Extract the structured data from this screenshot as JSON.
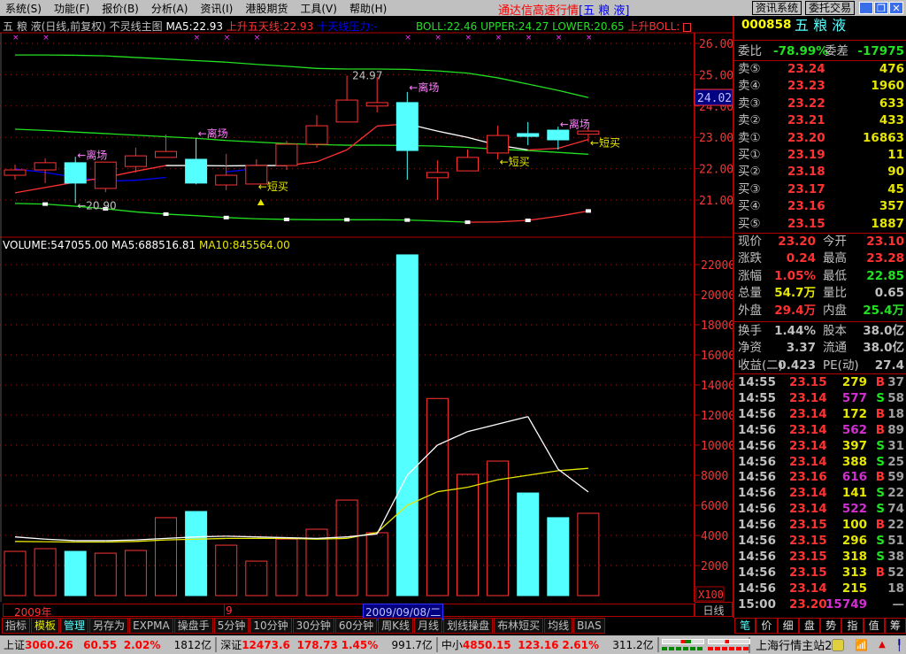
{
  "menu": [
    "系统(S)",
    "功能(F)",
    "报价(B)",
    "分析(A)",
    "资讯(I)",
    "港股期货",
    "工具(V)",
    "帮助(H)"
  ],
  "app_title": "通达信高速行情",
  "app_stock": "[五 粮 液]",
  "top_buttons": {
    "news": "资讯系统",
    "trade": "委托交易"
  },
  "window_controls": {
    "minimize": "_",
    "restore": "❐",
    "close": "✕"
  },
  "chart_header": {
    "name": "五 粮 液(日线,前复权) 不灵线主图",
    "ma5": "MA5:22.93",
    "up5": "上升五天线:22.93",
    "ten": "十天线压力:-",
    "boll": "BOLL:22.46",
    "upper": "UPPER:24.27",
    "lower": "LOWER:20.65",
    "upboll": "上升BOLL:"
  },
  "volume_header": {
    "vol": "VOLUME:547055.00",
    "ma5": "MA5:688516.81",
    "ma10": "MA10:845564.00"
  },
  "chart_data": [
    {
      "type": "candlestick",
      "title": "五粮液 日线",
      "price_ticks": [
        "26.00",
        "25.00",
        "24.00",
        "23.00",
        "22.00",
        "21.00"
      ],
      "price_range": [
        20.0,
        26.4
      ],
      "current_price_tag": "24.02",
      "candles": [
        {
          "o": 21.79,
          "h": 22.13,
          "l": 21.65,
          "c": 21.96
        },
        {
          "o": 21.96,
          "h": 22.33,
          "l": 21.54,
          "c": 22.19
        },
        {
          "o": 22.19,
          "h": 22.38,
          "l": 20.9,
          "c": 21.54
        },
        {
          "o": 21.37,
          "h": 22.21,
          "l": 21.25,
          "c": 22.21
        },
        {
          "o": 22.07,
          "h": 22.67,
          "l": 21.88,
          "c": 22.41
        },
        {
          "o": 22.36,
          "h": 23.09,
          "l": 22.36,
          "c": 22.55
        },
        {
          "o": 22.3,
          "h": 22.98,
          "l": 21.5,
          "c": 21.54
        },
        {
          "o": 21.48,
          "h": 22.47,
          "l": 21.31,
          "c": 21.79
        },
        {
          "o": 21.51,
          "h": 22.3,
          "l": 21.51,
          "c": 22.1
        },
        {
          "o": 22.1,
          "h": 22.89,
          "l": 21.96,
          "c": 22.78
        },
        {
          "o": 22.78,
          "h": 23.71,
          "l": 22.67,
          "c": 23.37
        },
        {
          "o": 23.49,
          "h": 24.97,
          "l": 23.49,
          "c": 24.19
        },
        {
          "o": 24.0,
          "h": 24.93,
          "l": 23.8,
          "c": 24.11
        },
        {
          "o": 24.11,
          "h": 24.45,
          "l": 21.65,
          "c": 22.58
        },
        {
          "o": 21.71,
          "h": 22.27,
          "l": 21.0,
          "c": 21.88
        },
        {
          "o": 21.93,
          "h": 22.61,
          "l": 21.93,
          "c": 22.36
        },
        {
          "o": 22.5,
          "h": 23.37,
          "l": 22.3,
          "c": 23.06
        },
        {
          "o": 23.12,
          "h": 23.49,
          "l": 22.75,
          "c": 23.03
        },
        {
          "o": 23.23,
          "h": 23.34,
          "l": 22.61,
          "c": 22.92
        },
        {
          "o": 23.1,
          "h": 23.28,
          "l": 22.85,
          "c": 23.2
        }
      ],
      "boll_upper": [
        25.63,
        25.63,
        25.62,
        25.6,
        25.55,
        25.5,
        25.45,
        25.4,
        25.33,
        25.27,
        25.2,
        25.18,
        25.18,
        25.17,
        25.12,
        25.05,
        24.9,
        24.7,
        24.5,
        24.27
      ],
      "boll_mid": [
        23.26,
        23.22,
        23.17,
        23.12,
        23.07,
        23.02,
        22.97,
        22.9,
        22.85,
        22.8,
        22.77,
        22.75,
        22.75,
        22.74,
        22.72,
        22.68,
        22.62,
        22.58,
        22.52,
        22.46
      ],
      "boll_lower": [
        20.89,
        20.87,
        20.8,
        20.72,
        20.62,
        20.55,
        20.5,
        20.44,
        20.4,
        20.38,
        20.37,
        20.37,
        20.37,
        20.36,
        20.33,
        20.29,
        20.3,
        20.35,
        20.48,
        20.65
      ],
      "up5_line": [
        21.23,
        21.4,
        21.57,
        21.72,
        21.92,
        22.1,
        22.1,
        22.09,
        22.1,
        22.1,
        22.22,
        22.6,
        23.36,
        23.43,
        23.2,
        23.0,
        22.75,
        22.6,
        22.65,
        22.93
      ],
      "ten_pressure": [
        21.99,
        21.88,
        21.72,
        21.6,
        21.63,
        21.72,
        null,
        21.9,
        22.0,
        null,
        null,
        null,
        null,
        null,
        null,
        null,
        null,
        null,
        null,
        null
      ],
      "top_markers": [
        0,
        1,
        6,
        7,
        8,
        13,
        14,
        15,
        16,
        17,
        18,
        19
      ],
      "lower_markers": [
        1,
        3,
        5,
        7,
        9,
        11,
        13,
        15,
        17,
        19
      ],
      "annotations": [
        {
          "i": 2,
          "text": "←离场",
          "kind": "exit",
          "p": 22.45
        },
        {
          "i": 6,
          "text": "←离场",
          "kind": "exit",
          "p": 23.15
        },
        {
          "i": 13,
          "text": "←离场",
          "kind": "exit",
          "p": 24.62
        },
        {
          "i": 18,
          "text": "←离场",
          "kind": "exit",
          "p": 23.45
        },
        {
          "i": 8,
          "text": "←短买",
          "kind": "buy",
          "p": 21.45
        },
        {
          "i": 16,
          "text": "←短买",
          "kind": "buy",
          "p": 22.25
        },
        {
          "i": 19,
          "text": "←短买",
          "kind": "buy",
          "p": 22.85
        },
        {
          "i": 2,
          "text": "←20.90",
          "kind": "low",
          "p": 20.85
        },
        {
          "i": 11,
          "text": "24.97",
          "kind": "high",
          "p": 25.0
        }
      ],
      "buy_signal_index": 8
    },
    {
      "type": "bar",
      "title": "VOLUME (X100)",
      "unit_label": "X100",
      "volume_ticks": [
        "22000",
        "20000",
        "18000",
        "16000",
        "14000",
        "12000",
        "10000",
        "8000",
        "6000",
        "4000",
        "2000"
      ],
      "values": [
        2940,
        3120,
        2940,
        2820,
        3000,
        5180,
        5590,
        3350,
        2290,
        3760,
        4410,
        6350,
        4180,
        22650,
        13100,
        8060,
        8940,
        6820,
        5180,
        5470
      ],
      "down_days": [
        2,
        6,
        13,
        17,
        18
      ],
      "ma5": [
        3900,
        3750,
        3650,
        3650,
        3700,
        3800,
        3900,
        3950,
        3900,
        3850,
        3800,
        3900,
        4100,
        8000,
        10000,
        10900,
        11400,
        11900,
        8400,
        6890
      ],
      "ma10": [
        3600,
        3580,
        3560,
        3560,
        3600,
        3700,
        3750,
        3800,
        3800,
        3800,
        3750,
        3800,
        4200,
        6000,
        6900,
        7200,
        7700,
        8000,
        8300,
        8460
      ]
    }
  ],
  "date_bar": {
    "year": "2009年",
    "month": "9",
    "cursor_date": "2009/09/08/二",
    "period": "日线"
  },
  "bottom_tabs": [
    "指标",
    "模板",
    "管理",
    "另存为",
    "EXPMA",
    "操盘手",
    "5分钟",
    "10分钟",
    "30分钟",
    "60分钟",
    "周K线",
    "月线",
    "划线操盘",
    "布林短买",
    "均线",
    "BIAS"
  ],
  "quote": {
    "code": "000858",
    "name": "五 粮 液",
    "weibi_label": "委比",
    "weibi": "-78.99%",
    "weicha_label": "委差",
    "weicha": "-17975",
    "sell": [
      {
        "label": "卖⑤",
        "price": "23.24",
        "vol": "476"
      },
      {
        "label": "卖④",
        "price": "23.23",
        "vol": "1960"
      },
      {
        "label": "卖③",
        "price": "23.22",
        "vol": "633"
      },
      {
        "label": "卖②",
        "price": "23.21",
        "vol": "433"
      },
      {
        "label": "卖①",
        "price": "23.20",
        "vol": "16863"
      }
    ],
    "buy": [
      {
        "label": "买①",
        "price": "23.19",
        "vol": "11"
      },
      {
        "label": "买②",
        "price": "23.18",
        "vol": "90"
      },
      {
        "label": "买③",
        "price": "23.17",
        "vol": "45"
      },
      {
        "label": "买④",
        "price": "23.16",
        "vol": "357"
      },
      {
        "label": "买⑤",
        "price": "23.15",
        "vol": "1887"
      }
    ],
    "stats": [
      {
        "l1": "现价",
        "v1": "23.20",
        "c1": "red",
        "l2": "今开",
        "v2": "23.10",
        "c2": "red"
      },
      {
        "l1": "涨跌",
        "v1": "0.24",
        "c1": "red",
        "l2": "最高",
        "v2": "23.28",
        "c2": "red"
      },
      {
        "l1": "涨幅",
        "v1": "1.05%",
        "c1": "red",
        "l2": "最低",
        "v2": "22.85",
        "c2": "green"
      },
      {
        "l1": "总量",
        "v1": "54.7万",
        "c1": "yellow",
        "l2": "量比",
        "v2": "0.65",
        "c2": "gray"
      },
      {
        "l1": "外盘",
        "v1": "29.4万",
        "c1": "red",
        "l2": "内盘",
        "v2": "25.4万",
        "c2": "green"
      }
    ],
    "stats2": [
      {
        "l1": "换手",
        "v1": "1.44%",
        "l2": "股本",
        "v2": "38.0亿"
      },
      {
        "l1": "净资",
        "v1": "3.37",
        "l2": "流通",
        "v2": "38.0亿"
      },
      {
        "l1": "收益(二)",
        "v1": "0.423",
        "l2": "PE(动)",
        "v2": "27.4"
      }
    ],
    "ticks": [
      {
        "t": "14:55",
        "p": "23.15",
        "v": "279",
        "vc": "yellow",
        "bs": "B",
        "n": "37"
      },
      {
        "t": "14:55",
        "p": "23.14",
        "v": "577",
        "vc": "magenta",
        "bs": "S",
        "n": "58"
      },
      {
        "t": "14:56",
        "p": "23.14",
        "v": "172",
        "vc": "yellow",
        "bs": "B",
        "n": "18"
      },
      {
        "t": "14:56",
        "p": "23.14",
        "v": "562",
        "vc": "magenta",
        "bs": "B",
        "n": "89"
      },
      {
        "t": "14:56",
        "p": "23.14",
        "v": "397",
        "vc": "yellow",
        "bs": "S",
        "n": "31"
      },
      {
        "t": "14:56",
        "p": "23.14",
        "v": "388",
        "vc": "yellow",
        "bs": "S",
        "n": "25"
      },
      {
        "t": "14:56",
        "p": "23.16",
        "v": "616",
        "vc": "magenta",
        "bs": "B",
        "n": "59"
      },
      {
        "t": "14:56",
        "p": "23.14",
        "v": "141",
        "vc": "yellow",
        "bs": "S",
        "n": "22"
      },
      {
        "t": "14:56",
        "p": "23.14",
        "v": "522",
        "vc": "magenta",
        "bs": "S",
        "n": "74"
      },
      {
        "t": "14:56",
        "p": "23.15",
        "v": "100",
        "vc": "yellow",
        "bs": "B",
        "n": "22"
      },
      {
        "t": "14:56",
        "p": "23.15",
        "v": "296",
        "vc": "yellow",
        "bs": "S",
        "n": "51"
      },
      {
        "t": "14:56",
        "p": "23.15",
        "v": "318",
        "vc": "yellow",
        "bs": "S",
        "n": "38"
      },
      {
        "t": "14:56",
        "p": "23.15",
        "v": "313",
        "vc": "yellow",
        "bs": "B",
        "n": "52"
      },
      {
        "t": "14:56",
        "p": "23.14",
        "v": "215",
        "vc": "yellow",
        "bs": "",
        "n": "18"
      },
      {
        "t": "15:00",
        "p": "23.20",
        "v": "15749",
        "vc": "magenta",
        "bs": "",
        "n": "—"
      }
    ]
  },
  "right_tabs": [
    "笔",
    "价",
    "细",
    "盘",
    "势",
    "指",
    "值",
    "筹"
  ],
  "status": {
    "sh_label": "上证",
    "sh": "3060.26",
    "sh_chg": "60.55",
    "sh_pct": "2.02%",
    "sh_amt": "1812亿",
    "sz_label": "深证",
    "sz": "12473.6",
    "sz_chg": "178.73",
    "sz_pct": "1.45%",
    "sz_amt": "991.7亿",
    "zx_label": "中小",
    "zx": "4850.15",
    "zx_chg": "123.16",
    "zx_pct": "2.61%",
    "zx_amt": "311.2亿",
    "server": "上海行情主站2"
  },
  "colors": {
    "up": "#ff3232",
    "down": "#54ffff",
    "border": "#b00000",
    "boll": "#22e022",
    "exit": "#ff80ff",
    "buy": "#e6e600"
  }
}
